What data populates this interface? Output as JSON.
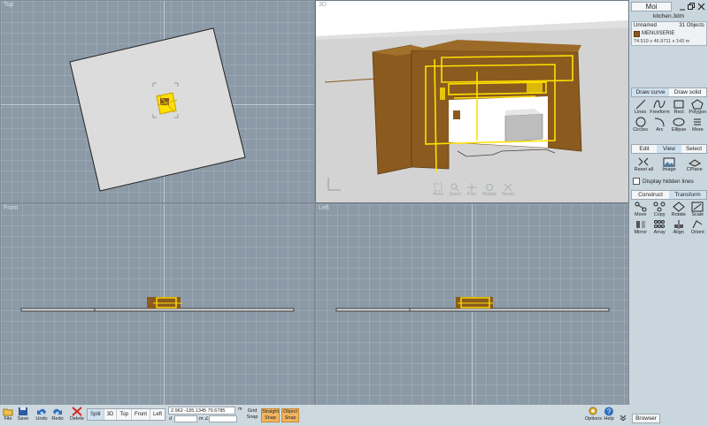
{
  "viewports": {
    "top": {
      "label": "Top"
    },
    "3d": {
      "label": "3D",
      "nav": [
        "Area",
        "Zoom",
        "Pan",
        "Rotate",
        "Reset"
      ]
    },
    "front": {
      "label": "Front"
    },
    "left": {
      "label": "Left"
    }
  },
  "panel": {
    "menu_label": "Moi",
    "file_name": "kitchen.3dm",
    "object_name": "Unnamed",
    "object_count": "31 Objects",
    "layer_name": "MENUISERIE",
    "layer_color": "#8a5a1f",
    "dimensions": "74.519 x 46.9711 x 143 m",
    "draw_tabs": [
      "Draw curve",
      "Draw solid"
    ],
    "draw_tools": [
      "Lines",
      "Freeform",
      "Rect",
      "Polygon",
      "Circles",
      "Arc",
      "Ellipse",
      "More"
    ],
    "view_tabs": [
      "Edit",
      "View",
      "Select"
    ],
    "view_tools": [
      "Reset all",
      "Image",
      "CPlane"
    ],
    "hidden_lines_label": "Display hidden lines",
    "construct_tabs": [
      "Construct",
      "Transform"
    ],
    "transform_tools": [
      "Move",
      "Copy",
      "Rotate",
      "Scale",
      "Mirror",
      "Array",
      "Align",
      "Orient"
    ],
    "browser_label": "Browser"
  },
  "bottom": {
    "file_label": "File",
    "save_label": "Save",
    "undo_label": "Undo",
    "redo_label": "Redo",
    "delete_label": "Delete",
    "view_buttons": [
      "Split",
      "3D",
      "Top",
      "Front",
      "Left"
    ],
    "coords": "2.962  -195.1345  79.6785",
    "units": "m",
    "d_label": "d",
    "angle_unit": "m ∠",
    "grid_snap": "Grid Snap",
    "straight_snap": "Straight Snap",
    "object_snap": "Object Snap",
    "options_label": "Options",
    "help_label": "Help"
  },
  "colors": {
    "accent": "#f1b561",
    "selection": "#ffe000",
    "model": "#8a5a1f"
  }
}
